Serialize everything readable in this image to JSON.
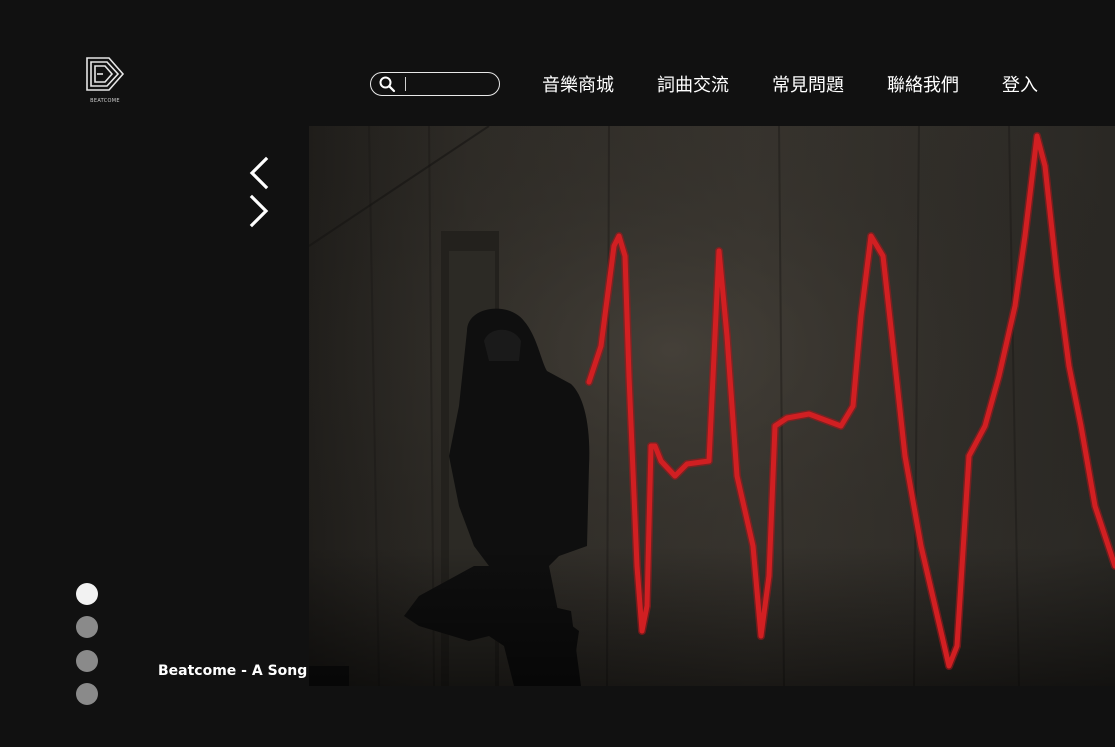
{
  "logo": {
    "icon": "beatcome-logo",
    "text": "BEATCOME"
  },
  "search": {
    "icon": "search-icon",
    "placeholder": "",
    "value": ""
  },
  "nav": {
    "items": [
      {
        "label": "音樂商城"
      },
      {
        "label": "詞曲交流"
      },
      {
        "label": "常見問題"
      },
      {
        "label": "聯絡我們"
      },
      {
        "label": "登入"
      }
    ]
  },
  "carousel": {
    "prev_icon": "chevron-left-icon",
    "next_icon": "chevron-right-icon",
    "caption": "Beatcome - A Song",
    "active_slide": 1,
    "slide_count": 4
  },
  "colors": {
    "background": "#111111",
    "text": "#ffffff",
    "accent_line": "#d11f22",
    "dot_active": "#f2f2f2",
    "dot_inactive": "#8a8a8a"
  }
}
